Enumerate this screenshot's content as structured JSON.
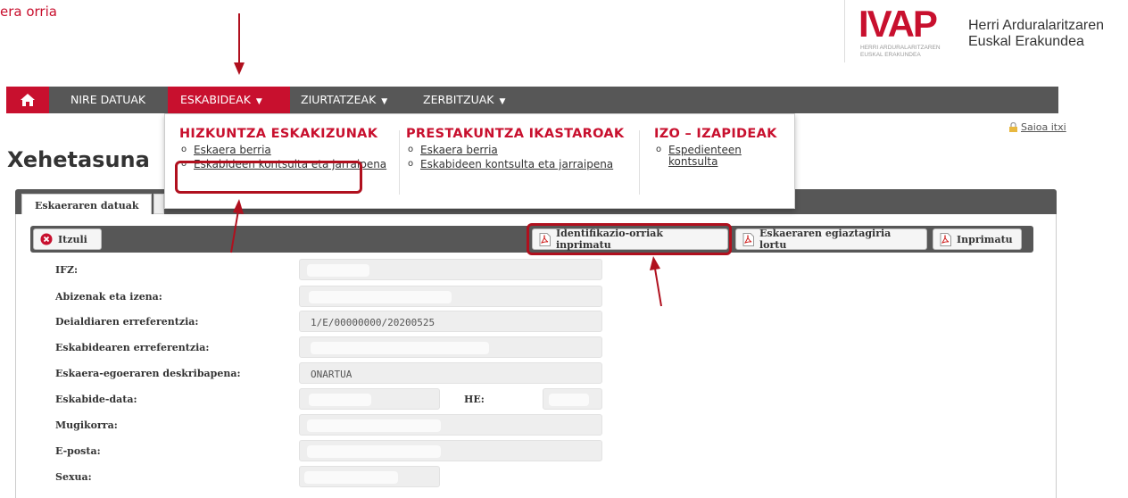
{
  "header": {
    "top_left_text": "era orria",
    "logo_mark": "IVAP",
    "logo_small_line1": "HERRI ARDURALARITZAREN",
    "logo_small_line2": "EUSKAL ERAKUNDEA",
    "logo_name_line1": "Herri Arduralaritzaren",
    "logo_name_line2": "Euskal Erakundea"
  },
  "nav": {
    "items": [
      {
        "label": "NIRE DATUAK"
      },
      {
        "label": "ESKABIDEAK"
      },
      {
        "label": "ZIURTATZEAK"
      },
      {
        "label": "ZERBITZUAK"
      }
    ]
  },
  "dropdown": {
    "columns": [
      {
        "heading": "HIZKUNTZA ESKAKIZUNAK",
        "items": [
          "Eskaera berria",
          "Eskabideen kontsulta eta jarraipena"
        ]
      },
      {
        "heading": "PRESTAKUNTZA IKASTAROAK",
        "items": [
          "Eskaera berria",
          "Eskabideen kontsulta eta jarraipena"
        ]
      },
      {
        "heading": "IZO – IZAPIDEAK",
        "items": [
          "Espedienteen kontsulta"
        ]
      }
    ]
  },
  "logout_label": "Saioa itxi",
  "page_title": "Xehetasuna",
  "tabs": {
    "active": "Eskaeraren datuak"
  },
  "toolbar": {
    "back": "Itzuli",
    "print_ids": "Identifikazio-orriak inprimatu",
    "get_proof": "Eskaeraren egiaztagiria lortu",
    "print": "Inprimatu"
  },
  "form": {
    "ifz_label": "IFZ:",
    "name_label": "Abizenak eta izena:",
    "call_ref_label": "Deialdiaren erreferentzia:",
    "call_ref_value": "1/E/00000000/20200525",
    "app_ref_label": "Eskabidearen erreferentzia:",
    "status_label": "Eskaera-egoeraren deskribapena:",
    "status_value": "ONARTUA",
    "date_label": "Eskabide-data:",
    "he_label": "HE:",
    "mobile_label": "Mugikorra:",
    "email_label": "E-posta:",
    "sex_label": "Sexua:"
  },
  "colors": {
    "accent": "#c8102e",
    "nav_bg": "#575757",
    "annotation": "#b0101e"
  }
}
